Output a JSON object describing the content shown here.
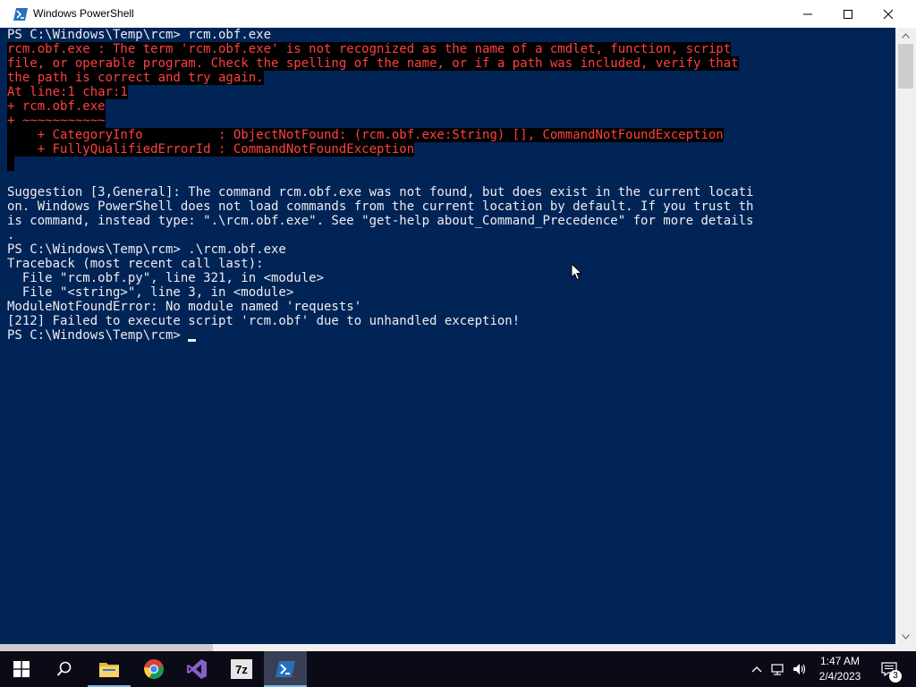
{
  "window": {
    "title": "Windows PowerShell"
  },
  "console": {
    "lines": [
      {
        "text": "PS C:\\Windows\\Temp\\rcm> rcm.obf.exe",
        "style": "out"
      },
      {
        "text": "rcm.obf.exe : The term 'rcm.obf.exe' is not recognized as the name of a cmdlet, function, script",
        "style": "err"
      },
      {
        "text": "file, or operable program. Check the spelling of the name, or if a path was included, verify that",
        "style": "err"
      },
      {
        "text": "the path is correct and try again.",
        "style": "err"
      },
      {
        "text": "At line:1 char:1",
        "style": "err"
      },
      {
        "text": "+ rcm.obf.exe",
        "style": "err"
      },
      {
        "text": "+ ~~~~~~~~~~~",
        "style": "err"
      },
      {
        "text": "    + CategoryInfo          : ObjectNotFound: (rcm.obf.exe:String) [], CommandNotFoundException",
        "style": "err"
      },
      {
        "text": "    + FullyQualifiedErrorId : CommandNotFoundException",
        "style": "err"
      },
      {
        "text": " ",
        "style": "err"
      },
      {
        "text": "",
        "style": "out"
      },
      {
        "text": "Suggestion [3,General]: The command rcm.obf.exe was not found, but does exist in the current locati",
        "style": "out"
      },
      {
        "text": "on. Windows PowerShell does not load commands from the current location by default. If you trust th",
        "style": "out"
      },
      {
        "text": "is command, instead type: \".\\rcm.obf.exe\". See \"get-help about_Command_Precedence\" for more details",
        "style": "out"
      },
      {
        "text": ".",
        "style": "out"
      },
      {
        "text": "PS C:\\Windows\\Temp\\rcm> .\\rcm.obf.exe",
        "style": "out"
      },
      {
        "text": "Traceback (most recent call last):",
        "style": "out"
      },
      {
        "text": "  File \"rcm.obf.py\", line 321, in <module>",
        "style": "out"
      },
      {
        "text": "  File \"<string>\", line 3, in <module>",
        "style": "out"
      },
      {
        "text": "ModuleNotFoundError: No module named 'requests'",
        "style": "out"
      },
      {
        "text": "[212] Failed to execute script 'rcm.obf' due to unhandled exception!",
        "style": "out"
      },
      {
        "text": "PS C:\\Windows\\Temp\\rcm> ",
        "style": "out",
        "cursor": true
      }
    ],
    "colors": {
      "background": "#012456",
      "foreground": "#eeedf0",
      "error_foreground": "#ff4040",
      "error_background": "#000000"
    }
  },
  "taskbar": {
    "items": [
      {
        "name": "start-button",
        "icon": "windows-logo-icon"
      },
      {
        "name": "search-button",
        "icon": "search-icon"
      },
      {
        "name": "file-explorer",
        "icon": "folder-icon"
      },
      {
        "name": "chrome",
        "icon": "chrome-icon"
      },
      {
        "name": "visual-studio",
        "icon": "visual-studio-icon"
      },
      {
        "name": "7zip",
        "icon": "7zip-icon",
        "label": "7z"
      },
      {
        "name": "powershell",
        "icon": "powershell-icon",
        "active": true
      }
    ],
    "clock": {
      "time": "1:47 AM",
      "date": "2/4/2023"
    },
    "notification_count": "3"
  }
}
